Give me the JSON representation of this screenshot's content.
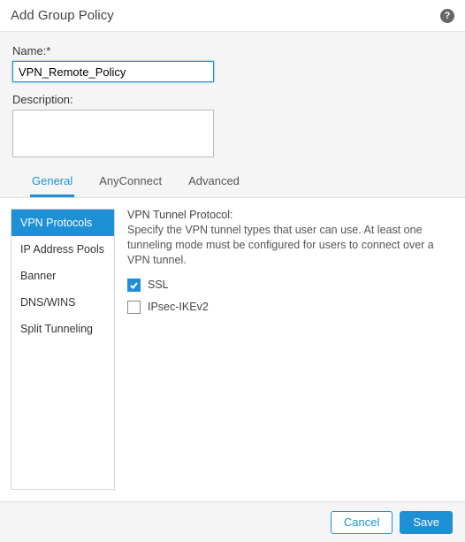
{
  "header": {
    "title": "Add Group Policy"
  },
  "form": {
    "name_label": "Name:*",
    "name_value": "VPN_Remote_Policy",
    "description_label": "Description:",
    "description_value": ""
  },
  "tabs": [
    {
      "label": "General",
      "active": true
    },
    {
      "label": "AnyConnect",
      "active": false
    },
    {
      "label": "Advanced",
      "active": false
    }
  ],
  "side_nav": [
    {
      "label": "VPN Protocols",
      "active": true
    },
    {
      "label": "IP Address Pools",
      "active": false
    },
    {
      "label": "Banner",
      "active": false
    },
    {
      "label": "DNS/WINS",
      "active": false
    },
    {
      "label": "Split Tunneling",
      "active": false
    }
  ],
  "content": {
    "heading": "VPN Tunnel Protocol:",
    "description": "Specify the VPN tunnel types that user can use. At least one tunneling mode must be configured for users to connect over a VPN tunnel.",
    "options": [
      {
        "label": "SSL",
        "checked": true
      },
      {
        "label": "IPsec-IKEv2",
        "checked": false
      }
    ]
  },
  "footer": {
    "cancel_label": "Cancel",
    "save_label": "Save"
  }
}
